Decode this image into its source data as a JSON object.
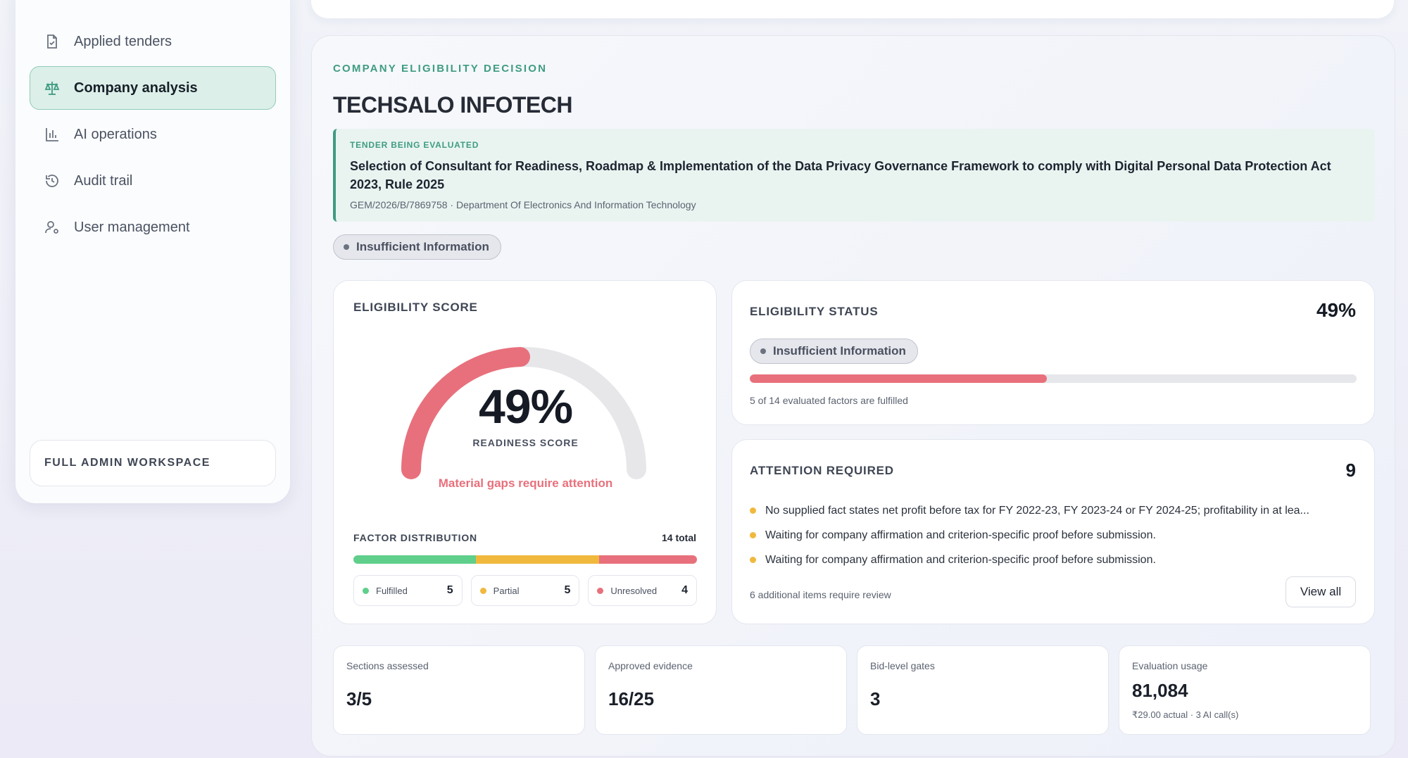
{
  "sidebar": {
    "items": [
      {
        "label": "Applied tenders",
        "icon": "file-icon",
        "active": false
      },
      {
        "label": "Company analysis",
        "icon": "scale-icon",
        "active": true
      },
      {
        "label": "AI operations",
        "icon": "bar-chart-icon",
        "active": false
      },
      {
        "label": "Audit trail",
        "icon": "history-icon",
        "active": false
      },
      {
        "label": "User management",
        "icon": "user-gear-icon",
        "active": false
      }
    ],
    "workspace_label": "FULL ADMIN WORKSPACE"
  },
  "header": {
    "eyebrow": "COMPANY ELIGIBILITY DECISION",
    "company": "TECHSALO INFOTECH"
  },
  "tender": {
    "eyebrow": "TENDER BEING EVALUATED",
    "title": "Selection of Consultant for Readiness, Roadmap & Implementation of the Data Privacy Governance Framework to comply with Digital Personal Data Protection Act 2023, Rule 2025",
    "meta": "GEM/2026/B/7869758 · Department Of Electronics And Information Technology"
  },
  "status_pill": "Insufficient Information",
  "score": {
    "label": "ELIGIBILITY SCORE",
    "value_text": "49%",
    "value": 49,
    "caption": "READINESS SCORE",
    "alert": "Material gaps require attention",
    "distribution_label": "FACTOR DISTRIBUTION",
    "distribution_total": "14 total",
    "factors": [
      {
        "label": "Fulfilled",
        "count": "5",
        "value": 5,
        "color": "#5fcf8b"
      },
      {
        "label": "Partial",
        "count": "5",
        "value": 5,
        "color": "#f0b93e"
      },
      {
        "label": "Unresolved",
        "count": "4",
        "value": 4,
        "color": "#e8707c"
      }
    ]
  },
  "status": {
    "label": "ELIGIBILITY STATUS",
    "percent_text": "49%",
    "percent": 49,
    "pill": "Insufficient Information",
    "note": "5 of 14 evaluated factors are fulfilled"
  },
  "attention": {
    "label": "ATTENTION REQUIRED",
    "count": "9",
    "items": [
      "No supplied fact states net profit before tax for FY 2022-23, FY 2023-24 or FY 2024-25; profitability in at lea...",
      "Waiting for company affirmation and criterion-specific proof before submission.",
      "Waiting for company affirmation and criterion-specific proof before submission."
    ],
    "more": "6 additional items require review",
    "view_all": "View all"
  },
  "stats": [
    {
      "label": "Sections assessed",
      "value": "3/5",
      "sub": ""
    },
    {
      "label": "Approved evidence",
      "value": "16/25",
      "sub": ""
    },
    {
      "label": "Bid-level gates",
      "value": "3",
      "sub": ""
    },
    {
      "label": "Evaluation usage",
      "value": "81,084",
      "sub": "₹29.00 actual · 3 AI call(s)"
    }
  ],
  "colors": {
    "accent": "#3f9c81",
    "alert": "#e8707c",
    "warning": "#f0b93e",
    "success": "#5fcf8b"
  }
}
